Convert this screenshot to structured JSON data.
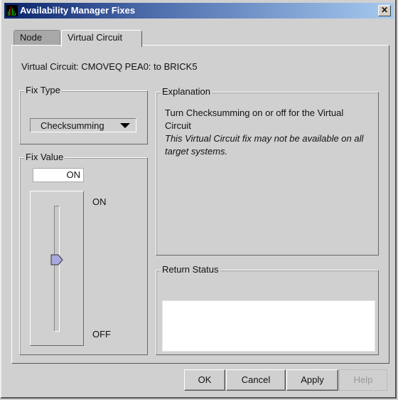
{
  "window": {
    "title": "Availability Manager Fixes",
    "close_glyph": "✕"
  },
  "tabs": [
    {
      "label": "Node",
      "selected": false
    },
    {
      "label": "Virtual Circuit",
      "selected": true
    }
  ],
  "virtual_circuit_label": "Virtual Circuit: CMOVEQ PEA0: to BRICK5",
  "fix_type": {
    "legend": "Fix Type",
    "selected": "Checksumming"
  },
  "fix_value": {
    "legend": "Fix Value",
    "value": "ON",
    "slider_on_label": "ON",
    "slider_off_label": "OFF",
    "slider_state": "ON"
  },
  "explanation": {
    "legend": "Explanation",
    "text": "Turn Checksumming on or off for the Virtual Circuit",
    "note": "This Virtual Circuit fix may not be available on all target systems."
  },
  "return_status": {
    "legend": "Return Status",
    "text": ""
  },
  "buttons": {
    "ok": "OK",
    "cancel": "Cancel",
    "apply": "Apply",
    "help": "Help"
  },
  "colors": {
    "title_gradient_start": "#0a246a",
    "title_gradient_end": "#a6caf0",
    "slider_thumb": "#a8a8e0"
  }
}
